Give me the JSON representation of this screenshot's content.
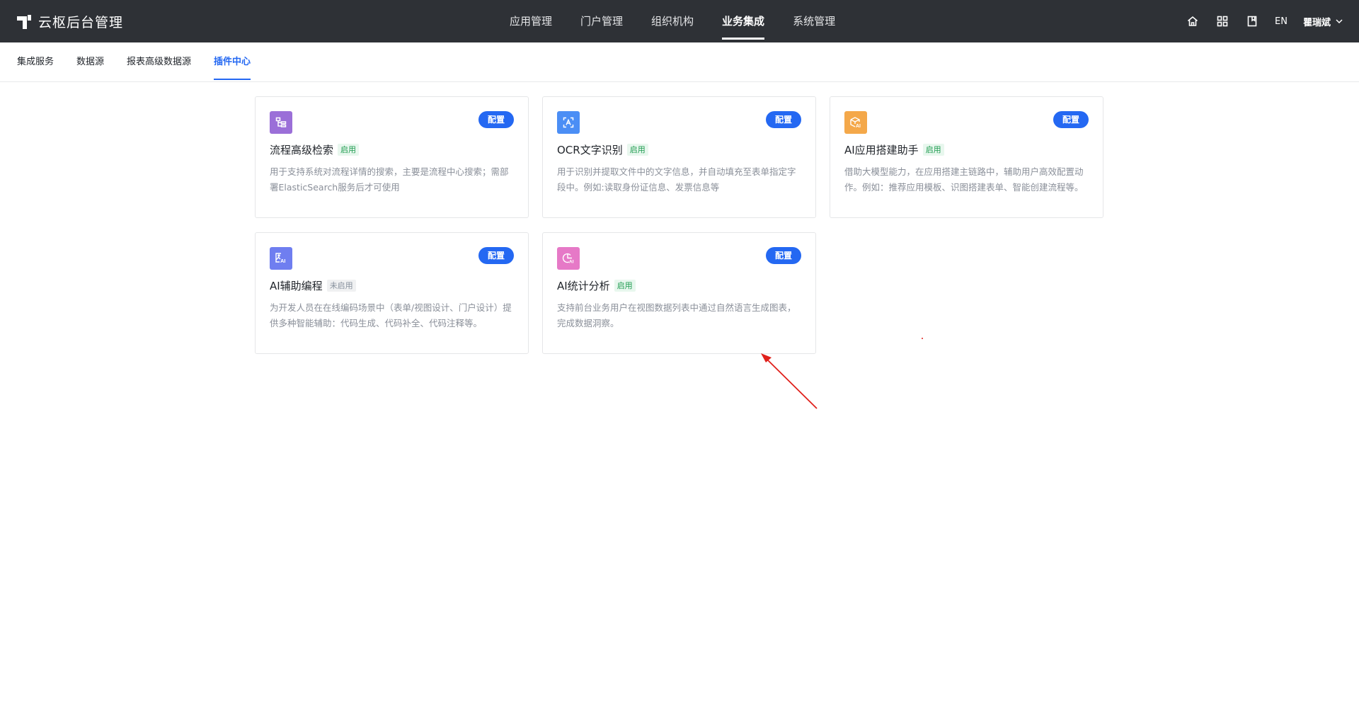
{
  "app": {
    "title": "云枢后台管理"
  },
  "main_nav": [
    {
      "label": "应用管理",
      "active": false
    },
    {
      "label": "门户管理",
      "active": false
    },
    {
      "label": "组织机构",
      "active": false
    },
    {
      "label": "业务集成",
      "active": true
    },
    {
      "label": "系统管理",
      "active": false
    }
  ],
  "toolbar": {
    "lang": "EN",
    "user_name": "瞿瑞斌"
  },
  "sub_nav": [
    {
      "label": "集成服务",
      "active": false
    },
    {
      "label": "数据源",
      "active": false
    },
    {
      "label": "报表高级数据源",
      "active": false
    },
    {
      "label": "插件中心",
      "active": true
    }
  ],
  "plugins": [
    {
      "title": "流程高级检索",
      "status": "启用",
      "enabled": true,
      "config_label": "配置",
      "icon": "flow-search-icon",
      "icon_color": "#9b6fd8",
      "description": "用于支持系统对流程详情的搜索，主要是流程中心搜索；需部署ElasticSearch服务后才可使用"
    },
    {
      "title": "OCR文字识别",
      "status": "启用",
      "enabled": true,
      "config_label": "配置",
      "icon": "ocr-scan-icon",
      "icon_color": "#4b8ef5",
      "description": "用于识别并提取文件中的文字信息，并自动填充至表单指定字段中。例如:读取身份证信息、发票信息等"
    },
    {
      "title": "AI应用搭建助手",
      "status": "启用",
      "enabled": true,
      "config_label": "配置",
      "icon": "ai-box-icon",
      "icon_color": "#f4a84a",
      "description": "借助大模型能力，在应用搭建主链路中，辅助用户高效配置动作。例如：推荐应用模板、识图搭建表单、智能创建流程等。"
    },
    {
      "title": "AI辅助编程",
      "status": "未启用",
      "enabled": false,
      "config_label": "配置",
      "icon": "ai-image-icon",
      "icon_color": "#6f7ef0",
      "description": "为开发人员在在线编码场景中（表单/视图设计、门户设计）提供多种智能辅助：代码生成、代码补全、代码注释等。"
    },
    {
      "title": "AI统计分析",
      "status": "启用",
      "enabled": true,
      "config_label": "配置",
      "icon": "ai-chart-icon",
      "icon_color": "#e679c7",
      "description": "支持前台业务用户在视图数据列表中通过自然语言生成图表，完成数据洞察。"
    }
  ],
  "colors": {
    "topbar": "#2e3136",
    "primary": "#2468f2",
    "annotation": "#e0211c"
  }
}
